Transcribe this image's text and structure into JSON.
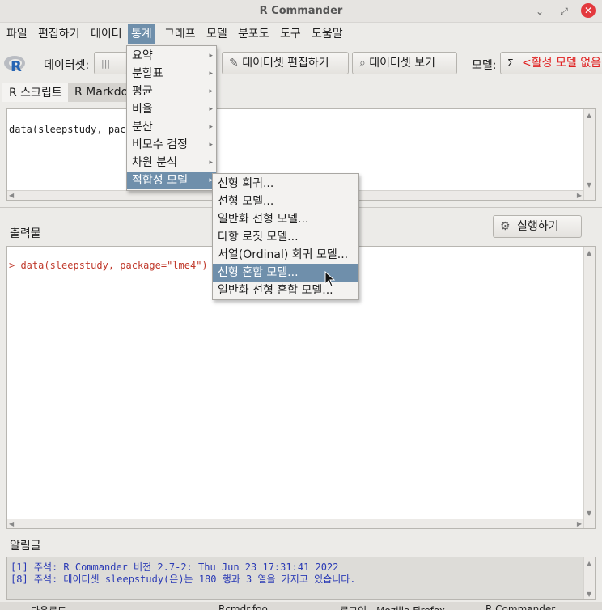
{
  "window": {
    "title": "R Commander"
  },
  "menubar": {
    "items": [
      "파일",
      "편집하기",
      "데이터",
      "통계",
      "그래프",
      "모델",
      "분포도",
      "도구",
      "도움말"
    ]
  },
  "toolbar": {
    "dataset_label": "데이터셋:",
    "edit_dataset": "데이터셋 편집하기",
    "view_dataset": "데이터셋 보기",
    "model_label": "모델:",
    "model_sigma": "Σ",
    "model_value": "<활성 모델 없음>"
  },
  "tabs": {
    "script": "R 스크립트",
    "markdown": "R Markdown"
  },
  "script": {
    "text": "data(sleepstudy, package=\"lme4\")",
    "visible_text": "data(sleepstudy, pack"
  },
  "run_button": "실행하기",
  "output": {
    "label": "출력물",
    "line": "> data(sleepstudy, package=\"lme4\")"
  },
  "messages": {
    "label": "알림글",
    "lines": [
      "[1] 주석: R Commander 버전 2.7-2: Thu Jun 23 17:31:41 2022",
      "[8] 주석: 데이터셋 sleepstudy(은)는 180 행과 3 열을 가지고 있습니다."
    ]
  },
  "stats_menu": {
    "items": [
      "요약",
      "분할표",
      "평균",
      "비율",
      "분산",
      "비모수 검정",
      "차원 분석",
      "적합성 모델"
    ],
    "highlighted_index": 7
  },
  "fit_models_menu": {
    "items": [
      "선형 회귀...",
      "선형 모델...",
      "일반화 선형 모델...",
      "다항 로짓 모델...",
      "서열(Ordinal) 회귀 모델...",
      "선형 혼합 모델...",
      "일반화 선형 혼합 모델..."
    ],
    "highlighted_index": 5
  },
  "taskbar": {
    "items": [
      "다운로드",
      "Rcmdr.foo",
      "로그인 - Mozilla Firefox",
      "R Commander"
    ]
  }
}
